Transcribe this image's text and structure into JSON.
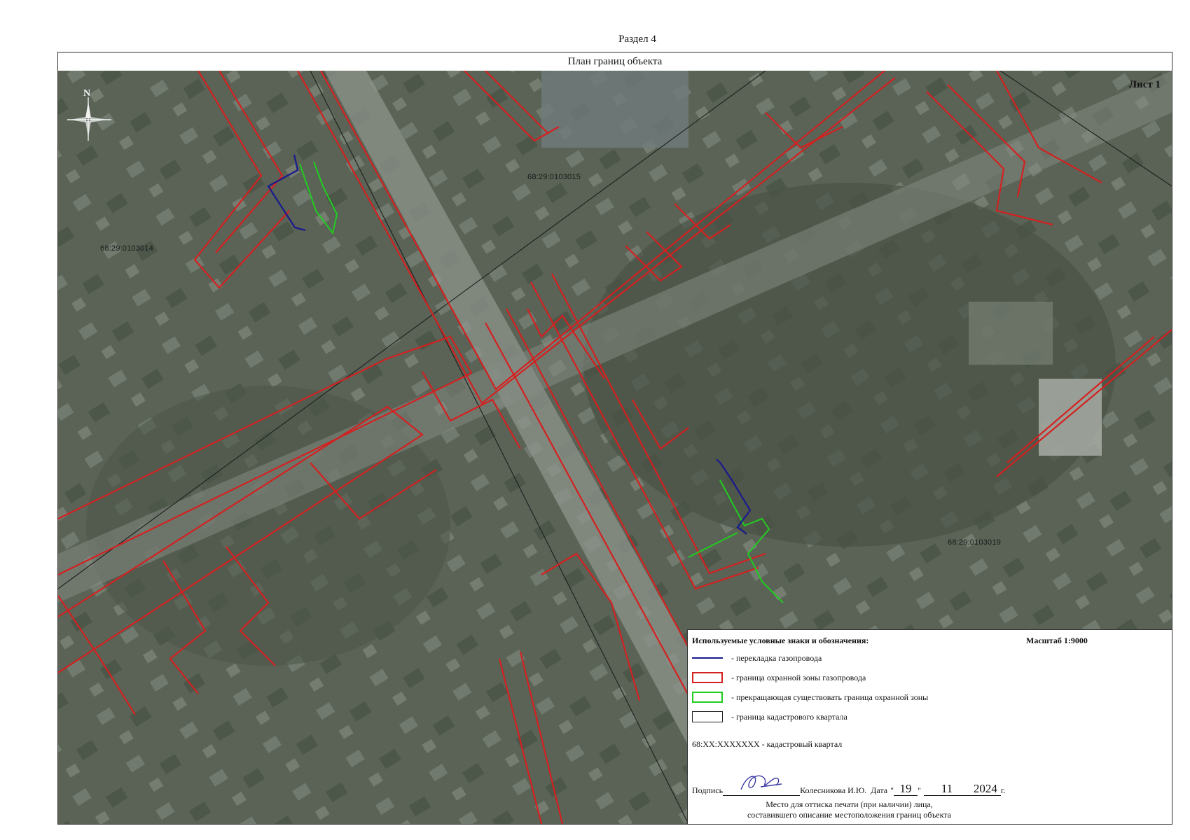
{
  "page": {
    "section_title": "Раздел 4",
    "plan_title": "План границ объекта",
    "sheet_label": "Лист 1",
    "north_label": "N"
  },
  "map": {
    "quarter_labels": [
      "68:29:0103015",
      "68:29:0103014",
      "68:29:0103019"
    ],
    "colors": {
      "gas_pipeline": "#1a1a8c",
      "protection_zone": "#d42020",
      "expiring_zone": "#22cc22",
      "quarter_boundary": "#222222",
      "imagery_base": "#5a6356"
    }
  },
  "legend": {
    "title": "Используемые условные знаки и обозначения:",
    "scale": "Масштаб 1:9000",
    "items": [
      {
        "symbol": "blue-line",
        "text": "- перекладка газопровода"
      },
      {
        "symbol": "red-box",
        "text": "- граница охранной зоны газопровода"
      },
      {
        "symbol": "green-box",
        "text": "- прекращающая существовать граница охранной зоны"
      },
      {
        "symbol": "black-box",
        "text": "- граница кадастрового квартала"
      }
    ],
    "quarter_note": "68:XX:XXXXXXX - кадастровый квартал"
  },
  "signature": {
    "label": "Подпись",
    "name": "Колесникова И.Ю.",
    "date_label": "Дата",
    "day": "19",
    "month": "11",
    "year": "2024",
    "year_suffix": "г.",
    "note_line1": "Место для оттиска печати (при наличии) лица,",
    "note_line2": "составившего описание местоположения границ объекта"
  }
}
